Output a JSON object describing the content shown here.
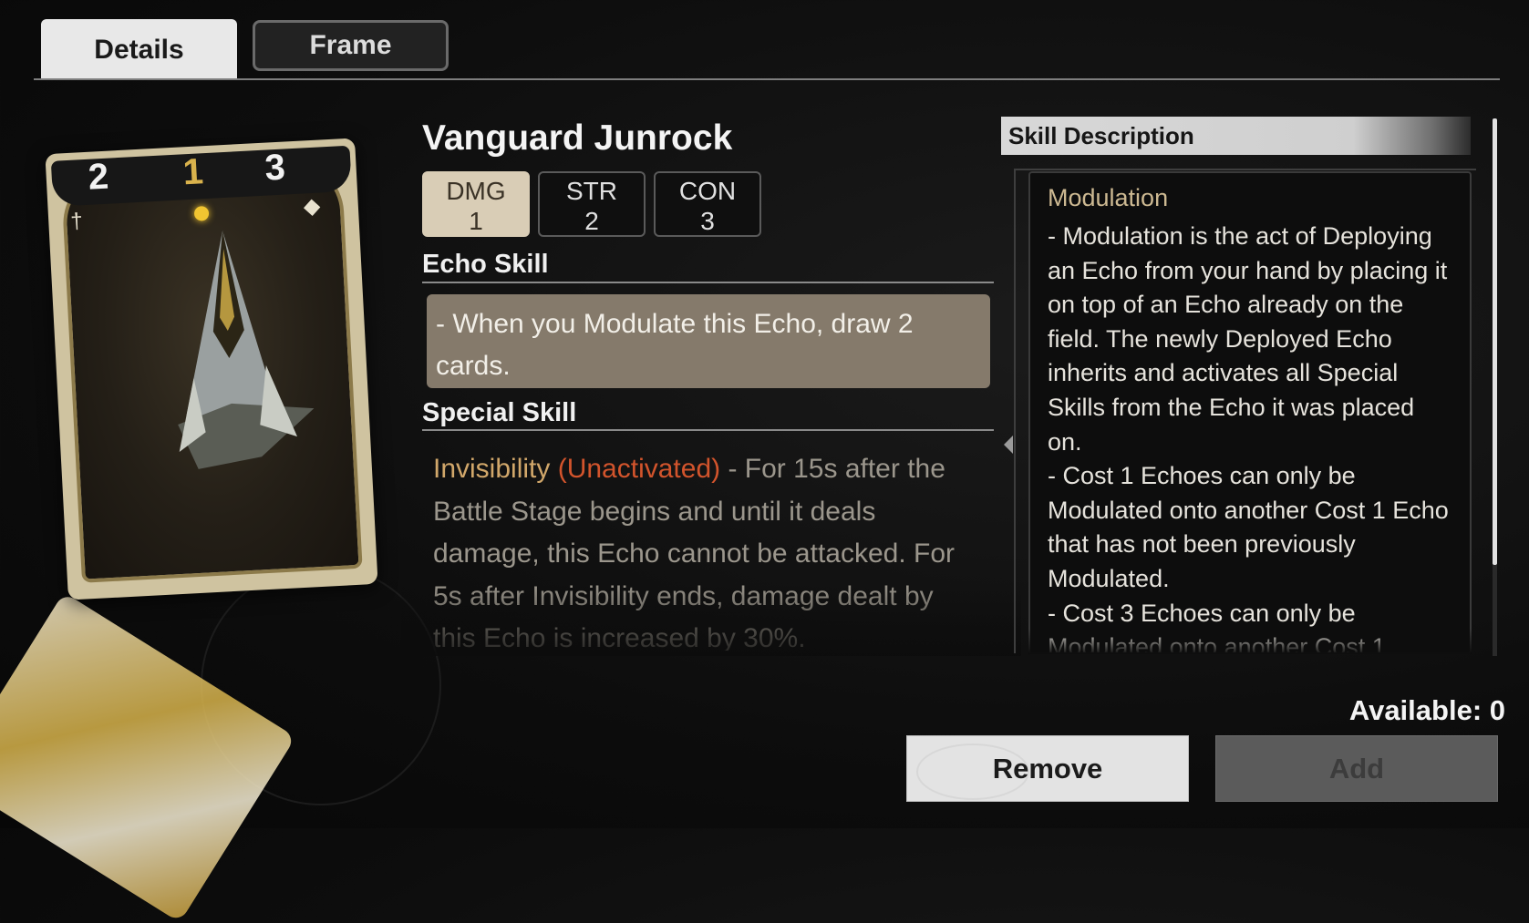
{
  "tabs": {
    "details": "Details",
    "frame": "Frame"
  },
  "card": {
    "cost_left": "2",
    "cost_mid": "1",
    "cost_right": "3",
    "left_icon": "sword-icon",
    "right_icon": "shield-icon"
  },
  "echo": {
    "name": "Vanguard Junrock",
    "stats": [
      {
        "label": "DMG",
        "value": "1"
      },
      {
        "label": "STR",
        "value": "2"
      },
      {
        "label": "CON",
        "value": "3"
      }
    ]
  },
  "echo_skill": {
    "title": "Echo Skill",
    "text": "- When you Modulate this Echo, draw 2 cards."
  },
  "special_skill": {
    "title": "Special Skill",
    "keyword": "Invisibility",
    "status": "(Unactivated)",
    "text": " - For 15s after the Battle Stage begins and until it deals damage, this Echo cannot be attacked. For 5s after Invisibility ends, damage dealt by this Echo is increased by 30%."
  },
  "skill_description": {
    "header": "Skill Description",
    "title": "Modulation",
    "body": "- Modulation is the act of Deploying an Echo from your hand by placing it on top of an Echo already on the field. The newly Deployed Echo inherits and activates all Special Skills from the Echo it was placed on.\n- Cost 1 Echoes can only be Modulated onto another Cost 1 Echo that has not been previously Modulated.\n- Cost 3 Echoes can only be Modulated onto another Cost 1"
  },
  "available": "Available: 0",
  "buttons": {
    "remove": "Remove",
    "add": "Add"
  },
  "colors": {
    "accent_tan": "#d9cdb6",
    "keyword": "#d1a76a",
    "warning": "#d2542c",
    "echo_box": "#857a6b"
  }
}
